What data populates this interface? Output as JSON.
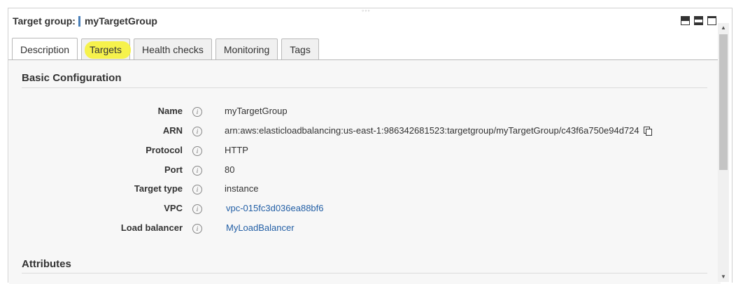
{
  "panel": {
    "header_label": "Target group:",
    "header_value": "myTargetGroup",
    "drag_handle": "◦◦◦"
  },
  "tabs": [
    {
      "label": "Description",
      "active": true
    },
    {
      "label": "Targets",
      "active": false,
      "highlighted": true
    },
    {
      "label": "Health checks",
      "active": false
    },
    {
      "label": "Monitoring",
      "active": false
    },
    {
      "label": "Tags",
      "active": false
    }
  ],
  "basic_configuration": {
    "title": "Basic Configuration",
    "rows": [
      {
        "key": "Name",
        "value": "myTargetGroup"
      },
      {
        "key": "ARN",
        "value": "arn:aws:elasticloadbalancing:us-east-1:986342681523:targetgroup/myTargetGroup/c43f6a750e94d724"
      },
      {
        "key": "Protocol",
        "value": "HTTP"
      },
      {
        "key": "Port",
        "value": "80"
      },
      {
        "key": "Target type",
        "value": "instance"
      },
      {
        "key": "VPC",
        "value": "vpc-015fc3d036ea88bf6"
      },
      {
        "key": "Load balancer",
        "value": "MyLoadBalancer"
      }
    ]
  },
  "attributes": {
    "title": "Attributes"
  },
  "icons": {
    "info": "info-icon",
    "copy": "copy-icon",
    "window_controls": [
      "minimize-panel-icon",
      "split-panel-icon",
      "maximize-panel-icon"
    ]
  },
  "colors": {
    "link": "#2460a6",
    "highlight": "#f6f23a",
    "accent_bar": "#4a7fb8"
  },
  "info_glyph": "i"
}
